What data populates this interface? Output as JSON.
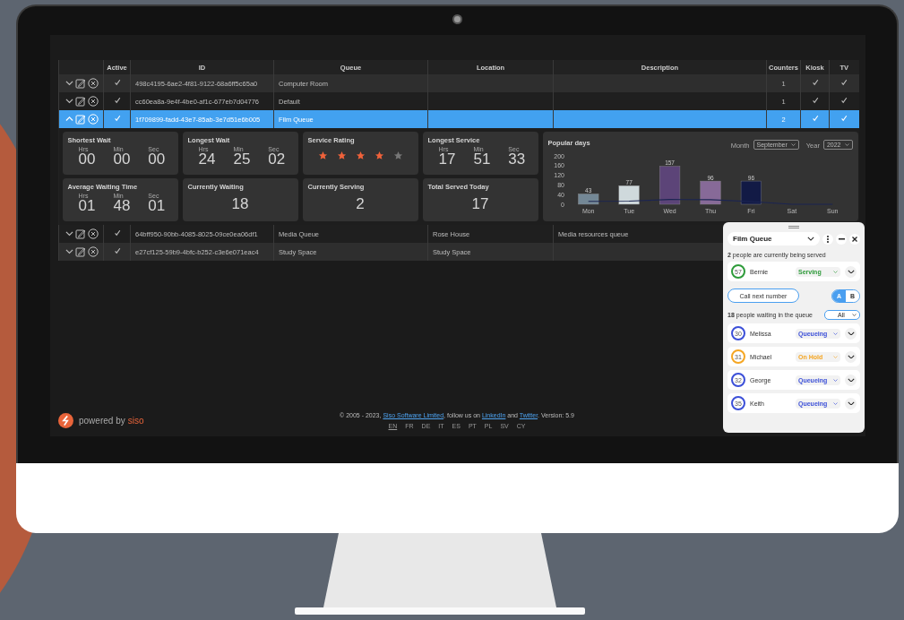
{
  "table": {
    "columns": [
      "Active",
      "ID",
      "Queue",
      "Location",
      "Description",
      "Counters",
      "Kiosk",
      "TV"
    ],
    "rows": [
      {
        "expanded": false,
        "selected": false,
        "active": true,
        "id": "498c4195-6ae2-4f81-9122-68a6ff5c65a0",
        "queue": "Computer Room",
        "location": "",
        "description": "",
        "counters": "1",
        "kiosk": true,
        "tv": true
      },
      {
        "expanded": false,
        "selected": false,
        "active": true,
        "id": "cc60ea8a-9e4f-4be0-af1c-677eb7d04776",
        "queue": "Default",
        "location": "",
        "description": "",
        "counters": "1",
        "kiosk": true,
        "tv": true
      },
      {
        "expanded": true,
        "selected": true,
        "active": true,
        "id": "1f709899-fadd-43e7-85ab-3e7d51e6b005",
        "queue": "Film Queue",
        "location": "",
        "description": "",
        "counters": "2",
        "kiosk": true,
        "tv": true,
        "details": {
          "cards": [
            {
              "kind": "time",
              "title": "Shortest Wait",
              "parts": [
                {
                  "unit": "Hrs",
                  "value": "00"
                },
                {
                  "unit": "Min",
                  "value": "00"
                },
                {
                  "unit": "Sec",
                  "value": "00"
                }
              ]
            },
            {
              "kind": "time",
              "title": "Longest Wait",
              "parts": [
                {
                  "unit": "Hrs",
                  "value": "24"
                },
                {
                  "unit": "Min",
                  "value": "25"
                },
                {
                  "unit": "Sec",
                  "value": "02"
                }
              ]
            },
            {
              "kind": "rating",
              "title": "Service Rating",
              "stars": 4
            },
            {
              "kind": "time",
              "title": "Longest Service",
              "parts": [
                {
                  "unit": "Hrs",
                  "value": "17"
                },
                {
                  "unit": "Min",
                  "value": "51"
                },
                {
                  "unit": "Sec",
                  "value": "33"
                }
              ]
            },
            {
              "kind": "time",
              "title": "Average Waiting Time",
              "parts": [
                {
                  "unit": "Hrs",
                  "value": "01"
                },
                {
                  "unit": "Min",
                  "value": "48"
                },
                {
                  "unit": "Sec",
                  "value": "01"
                }
              ]
            },
            {
              "kind": "count",
              "title": "Currently Waiting",
              "value": "18"
            },
            {
              "kind": "count",
              "title": "Currently Serving",
              "value": "2"
            },
            {
              "kind": "count",
              "title": "Total Served Today",
              "value": "17"
            }
          ],
          "popular_days": {
            "title": "Popular days",
            "month_label": "Month",
            "month": "September",
            "year_label": "Year",
            "year": "2022",
            "chart_data": {
              "type": "bar",
              "categories": [
                "Mon",
                "Tue",
                "Wed",
                "Thu",
                "Fri",
                "Sat",
                "Sun"
              ],
              "ylim": [
                0,
                200
              ],
              "yticks": [
                0,
                40,
                80,
                120,
                160,
                200
              ],
              "series": [
                {
                  "type": "bar",
                  "colors": [
                    "#748896",
                    "#cfd9dc",
                    "#5c4478",
                    "#876a98",
                    "#121a45",
                    null,
                    null
                  ],
                  "values": [
                    43,
                    77,
                    157,
                    96,
                    96,
                    null,
                    null
                  ],
                  "value_labels": [
                    "43",
                    "77",
                    "157",
                    "96",
                    "96",
                    null,
                    null
                  ]
                },
                {
                  "type": "line",
                  "color": "#1b2452",
                  "values": [
                    12,
                    13,
                    20,
                    19,
                    11,
                    0,
                    0
                  ]
                }
              ]
            }
          }
        }
      },
      {
        "expanded": false,
        "selected": false,
        "active": true,
        "id": "64bff950-90bb-4085-8025-09ce0ea06df1",
        "queue": "Media Queue",
        "location": "Rose House",
        "description": "Media resources queue"
      },
      {
        "expanded": false,
        "selected": false,
        "active": true,
        "id": "e27cf125-59b9-4bfc-b252-c3e6e071eac4",
        "queue": "Study Space",
        "location": "Study Space",
        "description": ""
      }
    ]
  },
  "footer": {
    "brand_prefix": "powered by",
    "brand": "siso",
    "copyright": [
      {
        "kind": "text",
        "text": "© 2005 - 2023, "
      },
      {
        "kind": "link",
        "text": "Siso Software Limited"
      },
      {
        "kind": "text",
        "text": ", follow us on "
      },
      {
        "kind": "link",
        "text": "LinkedIn"
      },
      {
        "kind": "text",
        "text": " and "
      },
      {
        "kind": "link",
        "text": "Twitter"
      },
      {
        "kind": "text",
        "text": ". Version: 5.9"
      }
    ],
    "languages": [
      {
        "label": "EN",
        "selected": true
      },
      {
        "label": "FR",
        "selected": false
      },
      {
        "label": "DE",
        "selected": false
      },
      {
        "label": "IT",
        "selected": false
      },
      {
        "label": "ES",
        "selected": false
      },
      {
        "label": "PT",
        "selected": false
      },
      {
        "label": "PL",
        "selected": false
      },
      {
        "label": "SV",
        "selected": false
      },
      {
        "label": "CY",
        "selected": false
      }
    ]
  },
  "widget": {
    "queue": "Film Queue",
    "serving_text": "**2** people are currently being served",
    "serving": [
      {
        "number": "57",
        "name": "Bernie",
        "status": "Serving",
        "color": "#2e9b3a"
      }
    ],
    "call_button": "Call next number",
    "counters": [
      {
        "label": "A",
        "selected": true
      },
      {
        "label": "B",
        "selected": false
      }
    ],
    "waiting_text": "**18** people waiting in the queue",
    "filter": "All",
    "waiting": [
      {
        "number": "30",
        "name": "Melissa",
        "status": "Queueing",
        "color": "#3b4fd8"
      },
      {
        "number": "31",
        "name": "Michael",
        "status": "On Hold",
        "color": "#f5a623"
      },
      {
        "number": "32",
        "name": "George",
        "status": "Queueing",
        "color": "#3b4fd8"
      },
      {
        "number": "35",
        "name": "Keith",
        "status": "Queueing",
        "color": "#3b4fd8"
      }
    ]
  }
}
